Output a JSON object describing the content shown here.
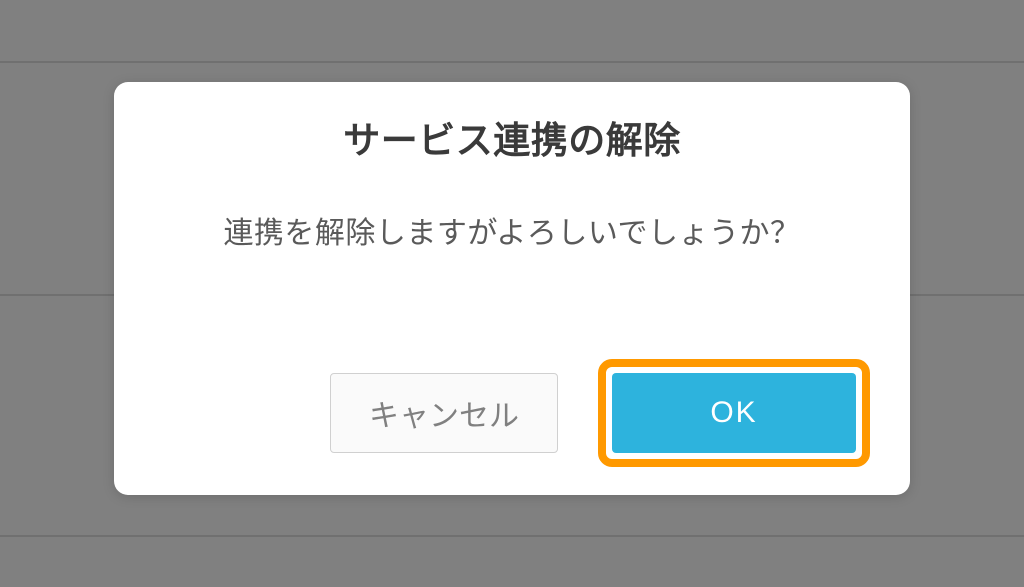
{
  "dialog": {
    "title": "サービス連携の解除",
    "message": "連携を解除しますがよろしいでしょうか？",
    "cancel_label": "キャンセル",
    "ok_label": "OK"
  }
}
